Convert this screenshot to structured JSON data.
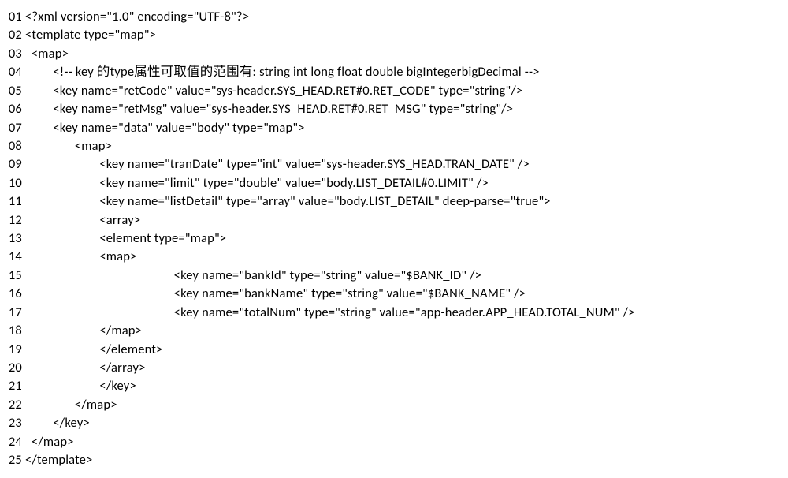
{
  "lines": [
    {
      "n": "01",
      "indent": "",
      "text": "<?xml version=\"1.0\" encoding=\"UTF-8\"?>"
    },
    {
      "n": "02",
      "indent": "",
      "text": "<template type=\"map\">"
    },
    {
      "n": "03",
      "indent": "  ",
      "text": "<map>"
    },
    {
      "n": "04",
      "indent": "         ",
      "text": "<!-- key 的type属性可取值的范围有: string int long float double bigIntegerbigDecimal -->"
    },
    {
      "n": "05",
      "indent": "         ",
      "text": "<key name=\"retCode\" value=\"sys-header.SYS_HEAD.RET#0.RET_CODE\" type=\"string\"/>"
    },
    {
      "n": "06",
      "indent": "         ",
      "text": "<key name=\"retMsg\" value=\"sys-header.SYS_HEAD.RET#0.RET_MSG\" type=\"string\"/>"
    },
    {
      "n": "07",
      "indent": "         ",
      "text": "<key name=\"data\" value=\"body\" type=\"map\">"
    },
    {
      "n": "08",
      "indent": "                ",
      "text": "<map>"
    },
    {
      "n": "09",
      "indent": "                        ",
      "text": "<key name=\"tranDate\" type=\"int\" value=\"sys-header.SYS_HEAD.TRAN_DATE\" />"
    },
    {
      "n": "10",
      "indent": "                        ",
      "text": "<key name=\"limit\" type=\"double\" value=\"body.LIST_DETAIL#0.LIMIT\" />"
    },
    {
      "n": "11",
      "indent": "                        ",
      "text": "<key name=\"listDetail\" type=\"array\" value=\"body.LIST_DETAIL\" deep-parse=\"true\">"
    },
    {
      "n": "12",
      "indent": "                        ",
      "text": "<array>"
    },
    {
      "n": "13",
      "indent": "                        ",
      "text": "<element type=\"map\">"
    },
    {
      "n": "14",
      "indent": "                        ",
      "text": "<map>"
    },
    {
      "n": "15",
      "indent": "                                                ",
      "text": "<key name=\"bankId\" type=\"string\" value=\"$BANK_ID\" />"
    },
    {
      "n": "16",
      "indent": "                                                ",
      "text": "<key name=\"bankName\" type=\"string\" value=\"$BANK_NAME\" />"
    },
    {
      "n": "17",
      "indent": "                                                ",
      "text": "<key name=\"totalNum\" type=\"string\" value=\"app-header.APP_HEAD.TOTAL_NUM\" />"
    },
    {
      "n": "18",
      "indent": "                        ",
      "text": "</map>"
    },
    {
      "n": "19",
      "indent": "                        ",
      "text": "</element>"
    },
    {
      "n": "20",
      "indent": "                        ",
      "text": "</array>"
    },
    {
      "n": "21",
      "indent": "                        ",
      "text": "</key>"
    },
    {
      "n": "22",
      "indent": "                ",
      "text": "</map>"
    },
    {
      "n": "23",
      "indent": "         ",
      "text": "</key>"
    },
    {
      "n": "24",
      "indent": "  ",
      "text": "</map>"
    },
    {
      "n": "25",
      "indent": "",
      "text": "</template>"
    }
  ]
}
